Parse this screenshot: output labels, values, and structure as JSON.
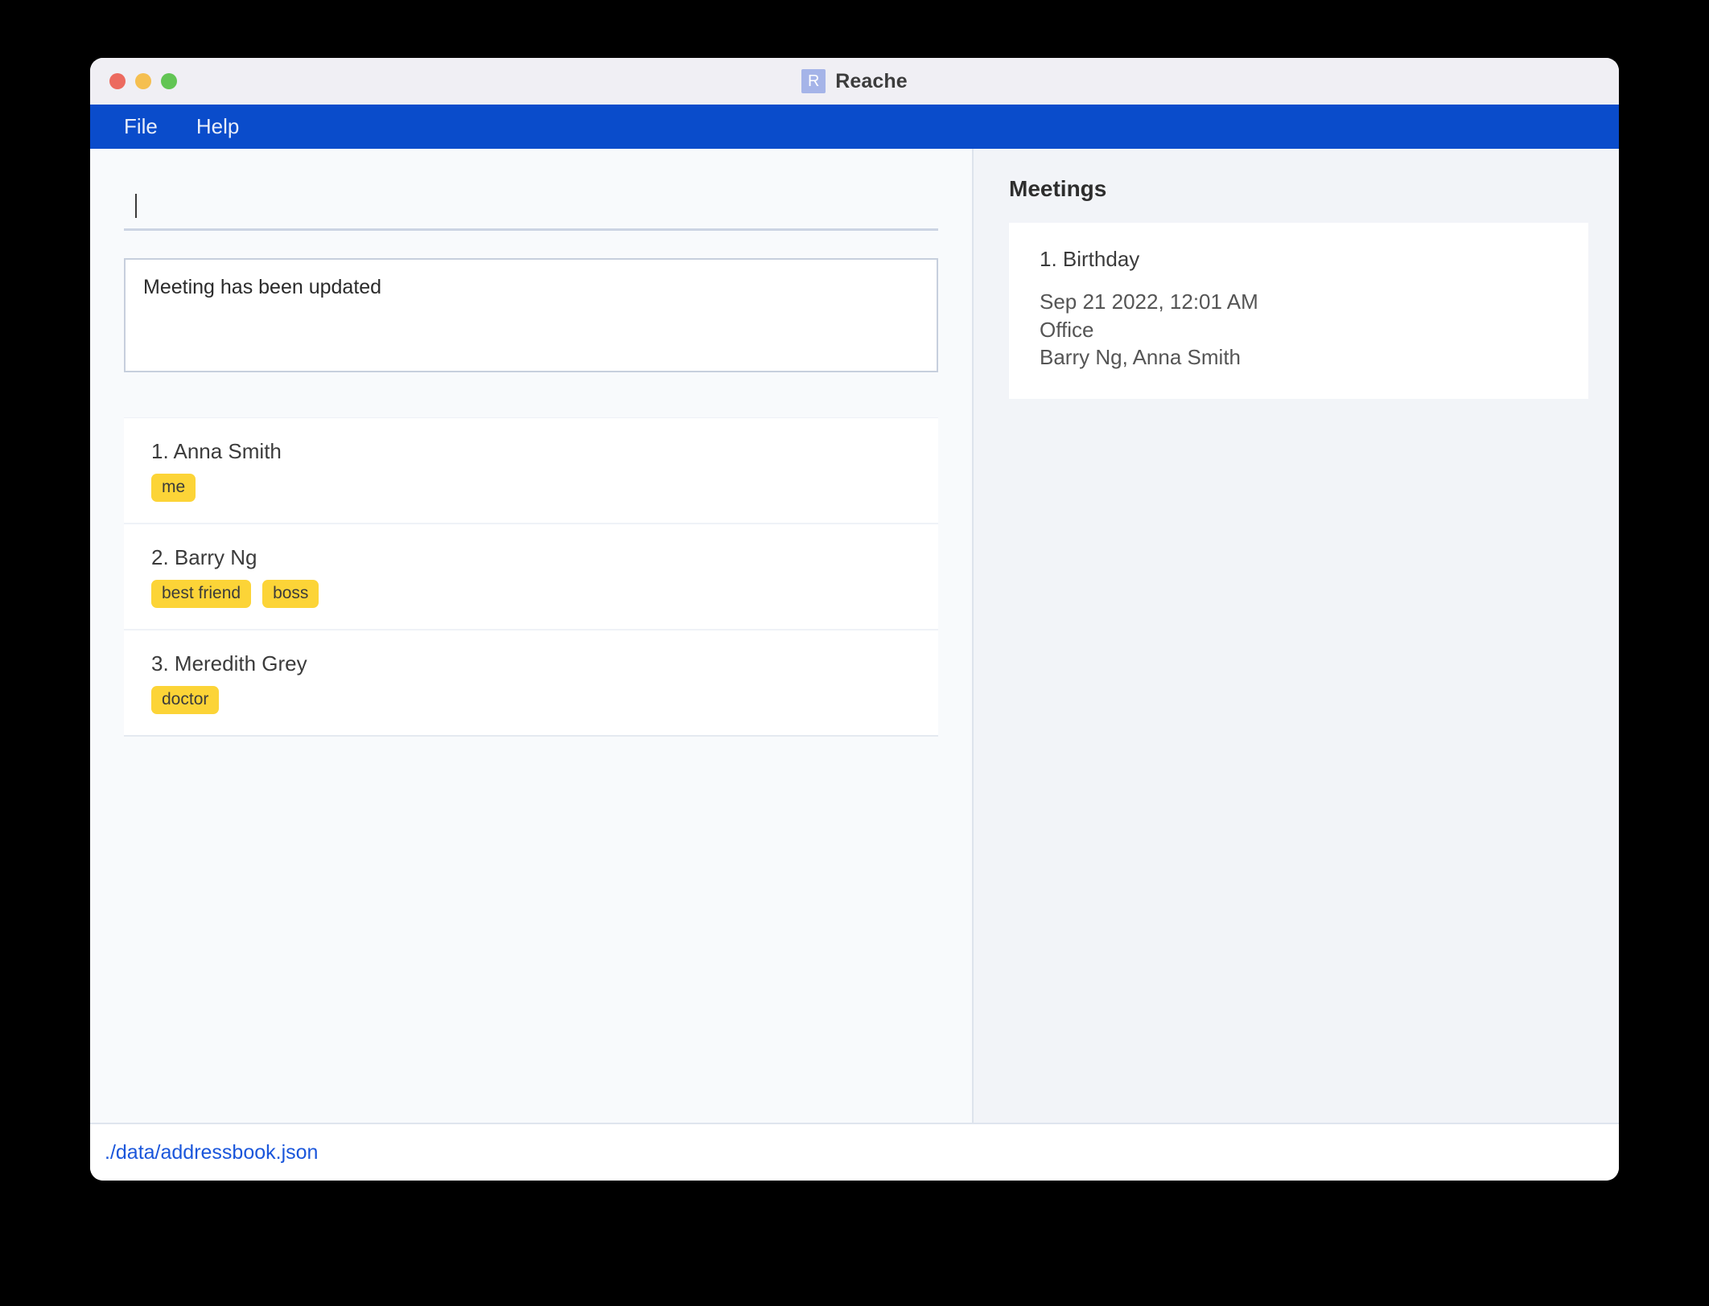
{
  "window": {
    "title": "Reache",
    "app_icon_letter": "R",
    "traffic_lights": [
      "close",
      "minimize",
      "maximize"
    ]
  },
  "menubar": {
    "items": [
      {
        "label": "File"
      },
      {
        "label": "Help"
      }
    ]
  },
  "command": {
    "value": "",
    "placeholder": ""
  },
  "result": {
    "message": "Meeting has been updated"
  },
  "contacts": {
    "items": [
      {
        "name": "1. Anna Smith",
        "tags": [
          "me"
        ]
      },
      {
        "name": "2. Barry Ng",
        "tags": [
          "best friend",
          "boss"
        ]
      },
      {
        "name": "3. Meredith Grey",
        "tags": [
          "doctor"
        ]
      }
    ]
  },
  "meetings": {
    "heading": "Meetings",
    "items": [
      {
        "title": "1. Birthday",
        "datetime": "Sep 21 2022, 12:01 AM",
        "location": "Office",
        "attendees": "Barry Ng, Anna Smith"
      }
    ]
  },
  "statusbar": {
    "file_path": "./data/addressbook.json"
  },
  "colors": {
    "menubar": "#0a4ccb",
    "tag": "#fcd437",
    "status_link": "#1a56db",
    "app_icon": "#a5b4e8"
  }
}
